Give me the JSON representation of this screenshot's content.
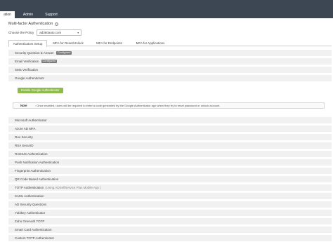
{
  "nav": {
    "tabs": [
      {
        "label": "ation"
      },
      {
        "label": "Admin"
      },
      {
        "label": "Support"
      }
    ]
  },
  "page": {
    "title": "Multi-factor Authentication"
  },
  "policy": {
    "label": "Choose the Policy",
    "value": "ad360auto.com"
  },
  "subtabs": [
    {
      "label": "Authenticators Setup"
    },
    {
      "label": "MFA for Reset/Unlock"
    },
    {
      "label": "MFA for Endpoints"
    },
    {
      "label": "MFA for Applications"
    }
  ],
  "authenticators_top": [
    {
      "label": "Security Question & Answer",
      "badge": "Configured"
    },
    {
      "label": "Email Verification",
      "badge": "Configured"
    },
    {
      "label": "SMS Verification",
      "badge": ""
    },
    {
      "label": "Google Authenticator",
      "badge": ""
    }
  ],
  "google_panel": {
    "enable_button": "Enable Google Authenticator",
    "note_label": "Note",
    "note_text": ": Once enabled, users will be required to enter a code generated by the Google Authenticator app when they try to reset password or unlock account."
  },
  "authenticators_bottom": [
    {
      "label": "Microsoft Authenticator",
      "sub": ""
    },
    {
      "label": "Azure AD MFA",
      "sub": ""
    },
    {
      "label": "Duo Security",
      "sub": ""
    },
    {
      "label": "RSA SecurID",
      "sub": ""
    },
    {
      "label": "RADIUS Authentication",
      "sub": ""
    },
    {
      "label": "Push Notification Authentication",
      "sub": ""
    },
    {
      "label": "Fingerprint Authentication",
      "sub": ""
    },
    {
      "label": "QR Code Based Authentication",
      "sub": ""
    },
    {
      "label": "TOTP Authentication",
      "sub": "(Using ADSelfService Plus Mobile App )"
    },
    {
      "label": "SAML Authentication",
      "sub": ""
    },
    {
      "label": "AD Security Questions",
      "sub": ""
    },
    {
      "label": "Yubikey Authenticator",
      "sub": ""
    },
    {
      "label": "Zoho OneAuth TOTP",
      "sub": ""
    },
    {
      "label": "Smart Card Authentication",
      "sub": ""
    },
    {
      "label": "Custom TOTP Authenticator",
      "sub": ""
    }
  ]
}
